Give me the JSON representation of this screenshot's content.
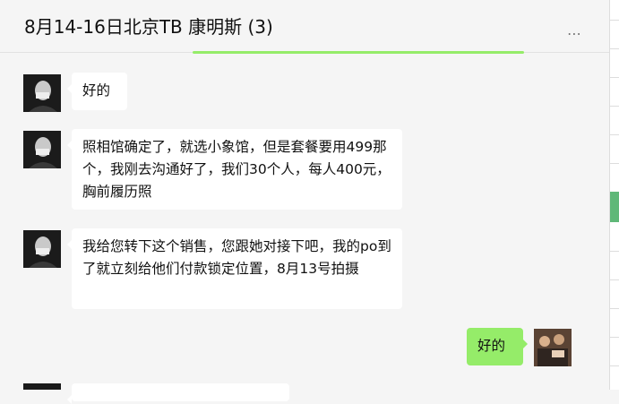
{
  "header": {
    "title": "8月14-16日北京TB 康明斯 (3)",
    "more_icon": "⋯",
    "minimize_icon": "─",
    "close_icon": "✕"
  },
  "messages": [
    {
      "side": "left",
      "text": "好的"
    },
    {
      "side": "left",
      "text": "照相馆确定了，就选小象馆，但是套餐要用499那个，我刚去沟通好了，我们30个人，每人400元，胸前履历照"
    },
    {
      "side": "left",
      "text": "我给您转下这个销售，您跟她对接下吧，我的po到了就立刻给他们付款锁定位置，8月13号拍摄"
    },
    {
      "side": "right",
      "text": "好的"
    }
  ],
  "colors": {
    "self_bubble": "#95ec69",
    "other_bubble": "#ffffff",
    "background": "#f5f5f5"
  }
}
